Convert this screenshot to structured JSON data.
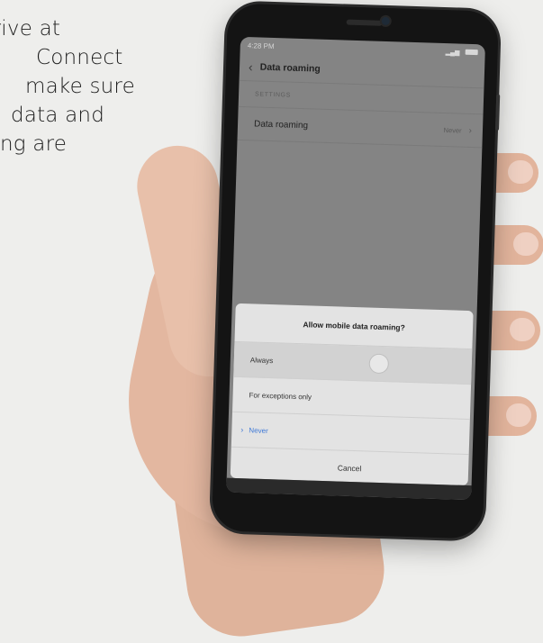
{
  "intro": {
    "lines": [
      "rrive at",
      "Connect",
      "make sure",
      "data and",
      "ng are"
    ]
  },
  "phone": {
    "status_time": "4:28 PM",
    "app_title": "Data roaming",
    "section_header": "SETTINGS",
    "setting_label": "Data roaming",
    "setting_value": "Never",
    "dialog": {
      "title": "Allow mobile data roaming?",
      "options": [
        "Always",
        "For exceptions only",
        "Never"
      ],
      "selected": "Never",
      "cancel_label": "Cancel"
    }
  },
  "colors": {
    "accent": "#3f79d7",
    "screen_dim": "#848484",
    "dialog_bg": "#e3e3e3"
  },
  "icons": [
    "back-arrow-icon",
    "chevron-right-icon",
    "check-chevron-icon",
    "battery-icon",
    "signal-icon"
  ]
}
